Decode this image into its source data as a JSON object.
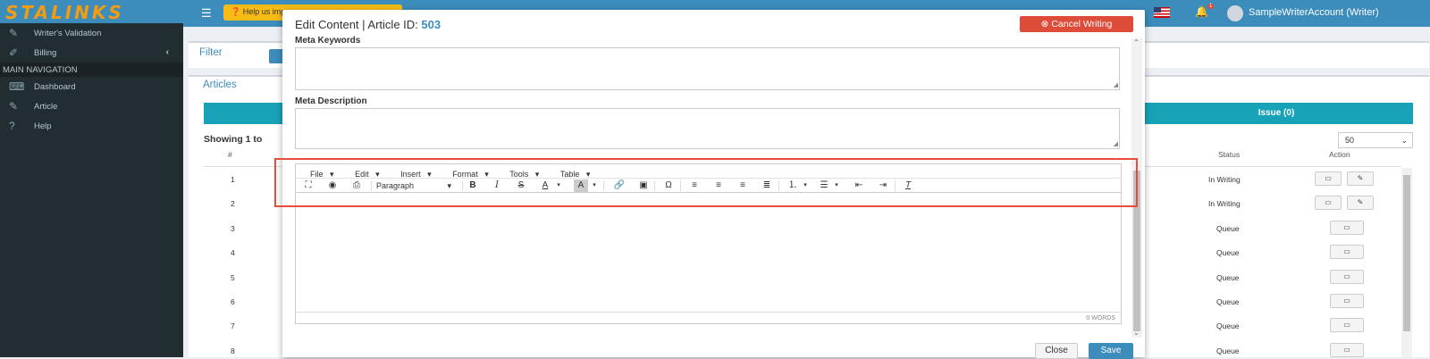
{
  "brand": "STALINKS",
  "sidebar": {
    "items_top": [
      {
        "label": "Writer's Validation",
        "icon": "edit-icon"
      },
      {
        "label": "Billing",
        "icon": "money-icon",
        "chevron": "‹"
      }
    ],
    "header": "MAIN NAVIGATION",
    "items_main": [
      {
        "label": "Dashboard",
        "icon": "keyboard-icon"
      },
      {
        "label": "Article",
        "icon": "edit-icon"
      },
      {
        "label": "Help",
        "icon": "question-icon"
      }
    ]
  },
  "topbar": {
    "help_label": "Help us improve",
    "user": "SampleWriterAccount (Writer)",
    "notification_count": "1"
  },
  "background": {
    "filter_title": "Filter",
    "articles_title": "Articles",
    "issue_label": "Issue (0)",
    "showing": "Showing 1 to",
    "page_size": "50",
    "columns": {
      "num": "#",
      "status": "Status",
      "action": "Action"
    },
    "rows": [
      {
        "num": "1",
        "status": "In Writing"
      },
      {
        "num": "2",
        "status": "In Writing"
      },
      {
        "num": "3",
        "status": "Queue"
      },
      {
        "num": "4",
        "status": "Queue"
      },
      {
        "num": "5",
        "status": "Queue"
      },
      {
        "num": "6",
        "status": "Queue"
      },
      {
        "num": "7",
        "status": "Queue"
      },
      {
        "num": "8",
        "status": "Queue"
      }
    ]
  },
  "modal": {
    "title_prefix": "Edit Content | Article ID: ",
    "article_id": "503",
    "cancel_label": "Cancel Writing",
    "meta_keywords_label": "Meta Keywords",
    "meta_description_label": "Meta Description",
    "editor": {
      "menus": [
        "File",
        "Edit",
        "Insert",
        "Format",
        "Tools",
        "Table"
      ],
      "format_select": "Paragraph",
      "word_count": "0 WORDS"
    },
    "close_label": "Close",
    "save_label": "Save"
  },
  "colors": {
    "brand_blue": "#3c8dbc",
    "danger": "#dd4b39",
    "cyan": "#17a2b8",
    "sidebar": "#222d32",
    "highlight": "#e74c3c"
  }
}
